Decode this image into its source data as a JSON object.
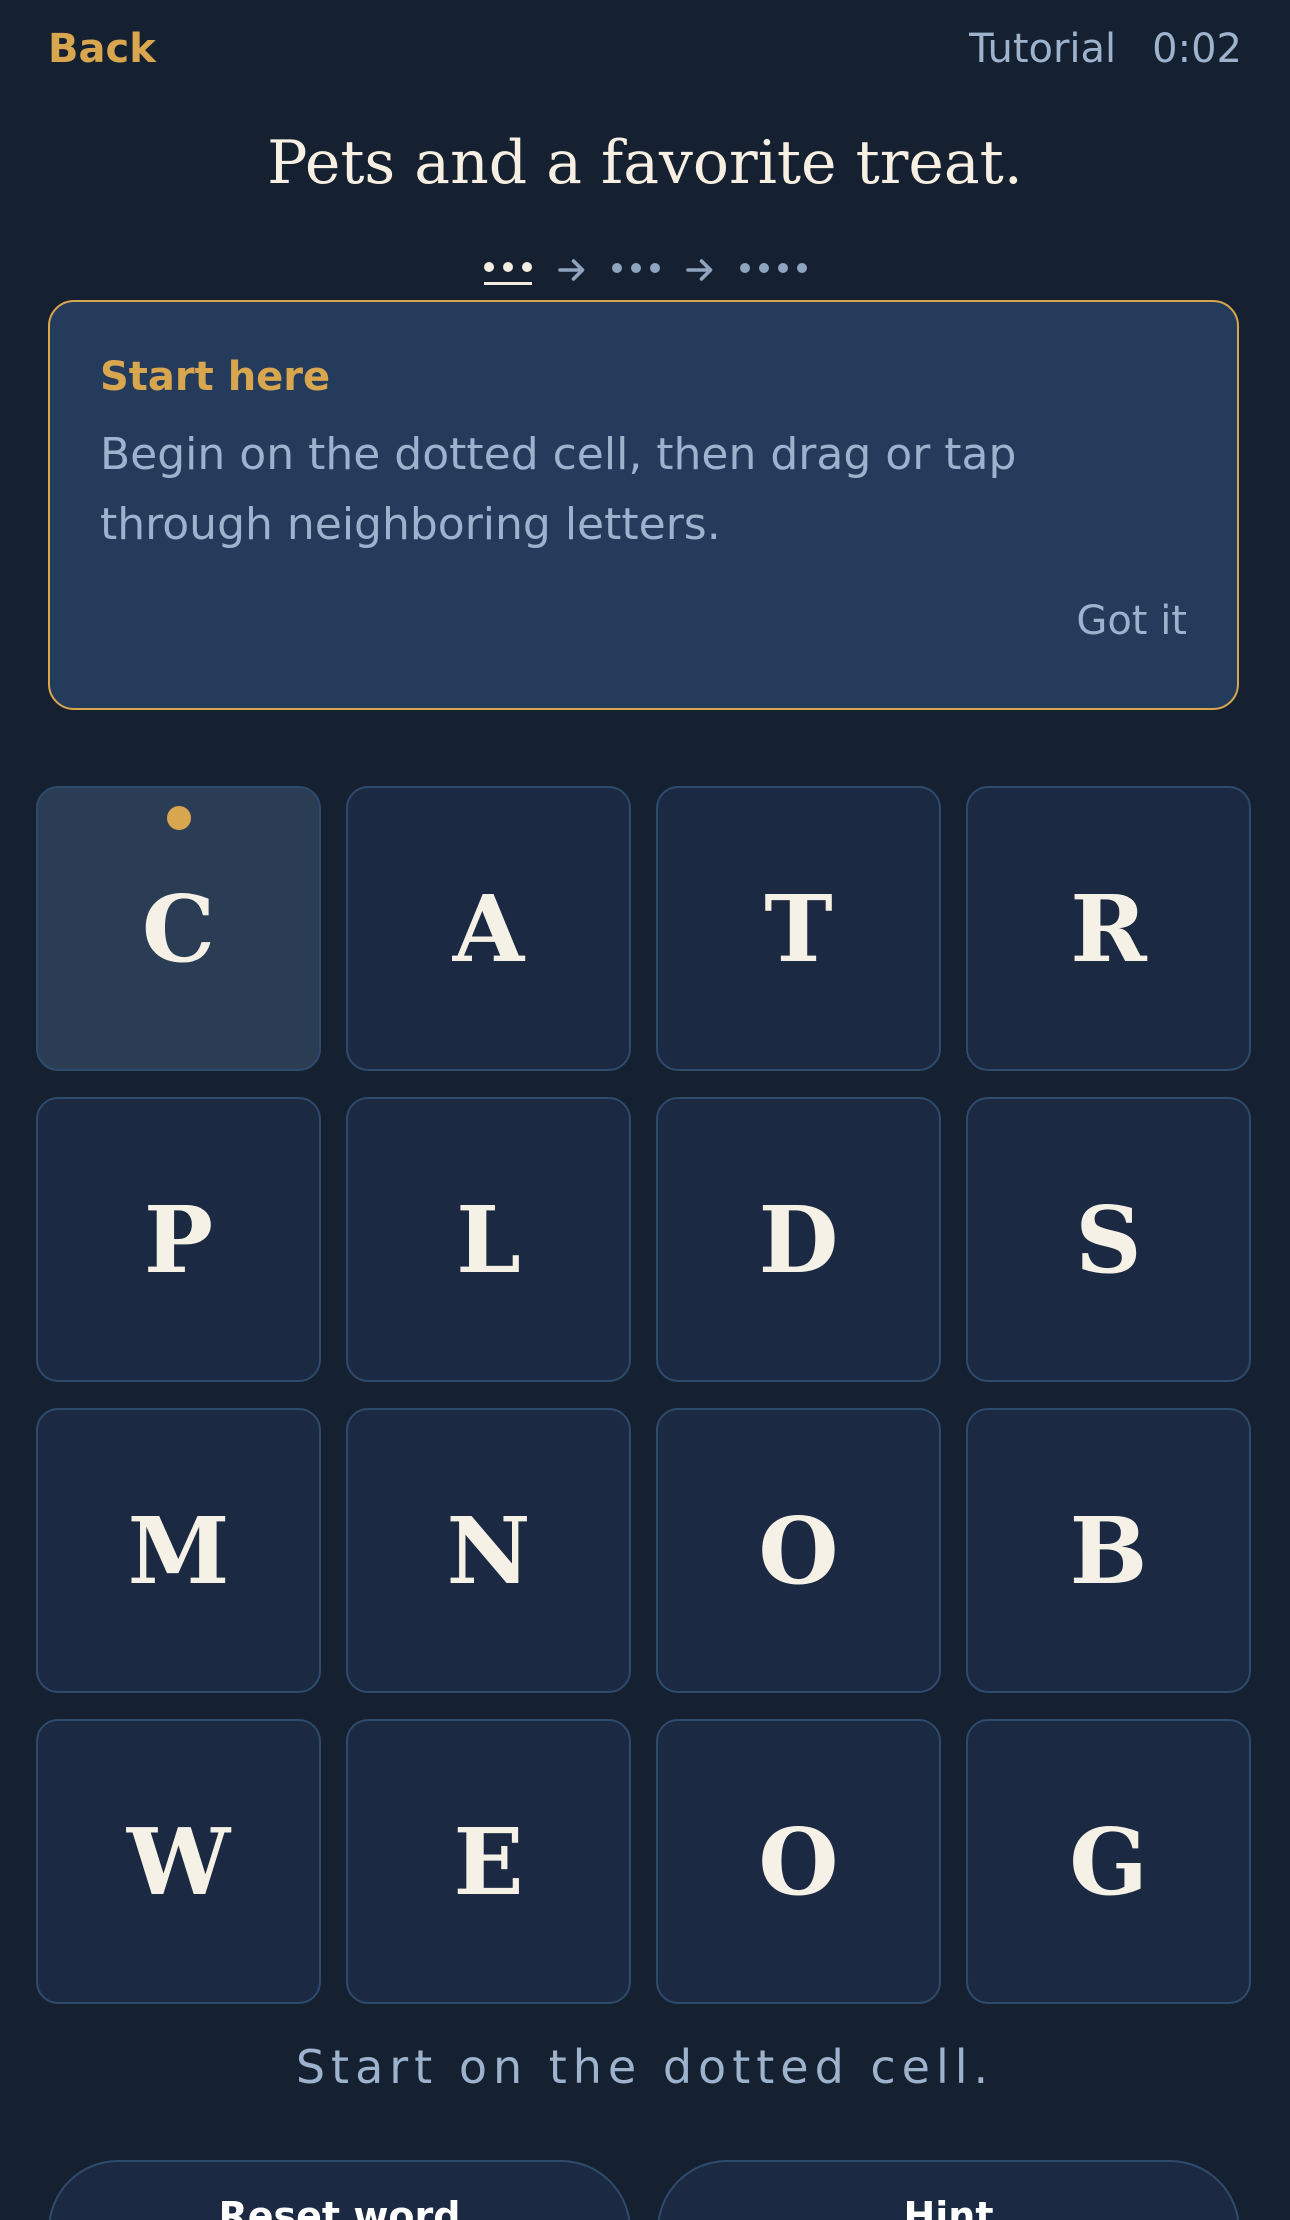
{
  "header": {
    "back_label": "Back",
    "tutorial_label": "Tutorial",
    "timer": "0:02"
  },
  "puzzle": {
    "title": "Pets and a favorite treat.",
    "word_lengths": [
      3,
      3,
      4
    ],
    "active_word_index": 0
  },
  "tip_card": {
    "heading": "Start here",
    "body": "Begin on the dotted cell, then drag or tap through neighboring letters.",
    "dismiss_label": "Got it"
  },
  "grid": {
    "start_cell_index": 0,
    "rows": [
      [
        "C",
        "A",
        "T",
        "R"
      ],
      [
        "P",
        "L",
        "D",
        "S"
      ],
      [
        "M",
        "N",
        "O",
        "B"
      ],
      [
        "W",
        "E",
        "O",
        "G"
      ]
    ]
  },
  "status_text": "Start on the dotted cell.",
  "actions": {
    "reset_label": "Reset word",
    "hint_label": "Hint"
  },
  "colors": {
    "background": "#152030",
    "accent": "#d9a650",
    "card": "#253b5b",
    "cell": "#1b2a42",
    "muted_text": "#9db2cc"
  }
}
